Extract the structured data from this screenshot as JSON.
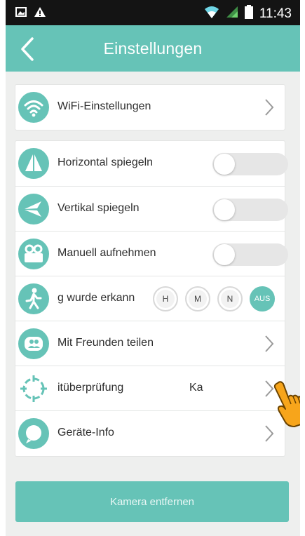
{
  "status_bar": {
    "time": "11:43"
  },
  "header": {
    "title": "Einstellungen"
  },
  "wifi_row": {
    "label": "WiFi-Einstellungen"
  },
  "settings": {
    "horizontal": {
      "label": "Horizontal spiegeln",
      "on": false
    },
    "vertical": {
      "label": "Vertikal spiegeln",
      "on": false
    },
    "manual_record": {
      "label": "Manuell aufnehmen",
      "on": false
    },
    "motion": {
      "label": "g wurde erkann",
      "options": [
        "H",
        "M",
        "N",
        "AUS"
      ],
      "selected": "AUS"
    },
    "share": {
      "label": "Mit Freunden teilen"
    },
    "check": {
      "label": "itüberprüfung",
      "value": "Ka"
    },
    "device_info": {
      "label": "Geräte-Info"
    }
  },
  "footer": {
    "remove_label": "Kamera entfernen"
  },
  "colors": {
    "accent": "#66c3b7",
    "status_bar": "#141414",
    "background": "#eeefee"
  }
}
